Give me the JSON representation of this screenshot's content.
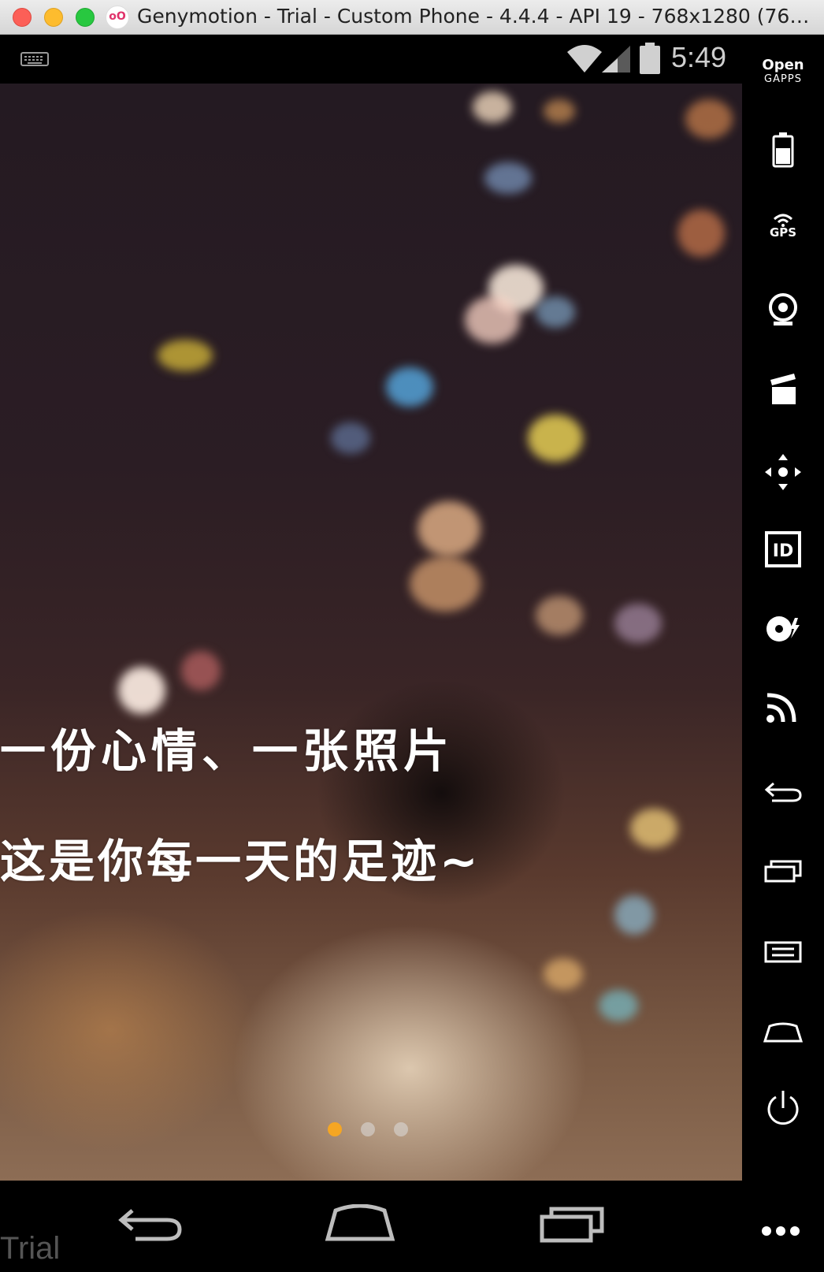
{
  "window": {
    "title": "Genymotion - Trial - Custom Phone - 4.4.4 - API 19 - 768x1280 (768x1...",
    "app_icon_glyph": "oO"
  },
  "statusbar": {
    "time": "5:49",
    "icons": [
      "keyboard-icon",
      "wifi-icon",
      "signal-icon",
      "battery-icon"
    ]
  },
  "banner": {
    "line1": "一份心情、一张照片",
    "line2": "这是你每一天的足迹~",
    "page_count": 3,
    "active_page": 1
  },
  "toolbar": {
    "opengapps_top": "Open",
    "opengapps_bottom": "GAPPS",
    "gps_label": "GPS",
    "items": [
      "battery",
      "gps",
      "webcam",
      "media",
      "dpad",
      "identifiers",
      "disk-io",
      "cast",
      "back",
      "recent-apps",
      "menu",
      "home",
      "power"
    ]
  },
  "footer": {
    "trial_label": "Trial"
  },
  "colors": {
    "active_dot": "#f5a623",
    "inactive_dot": "#dcdcdc"
  }
}
